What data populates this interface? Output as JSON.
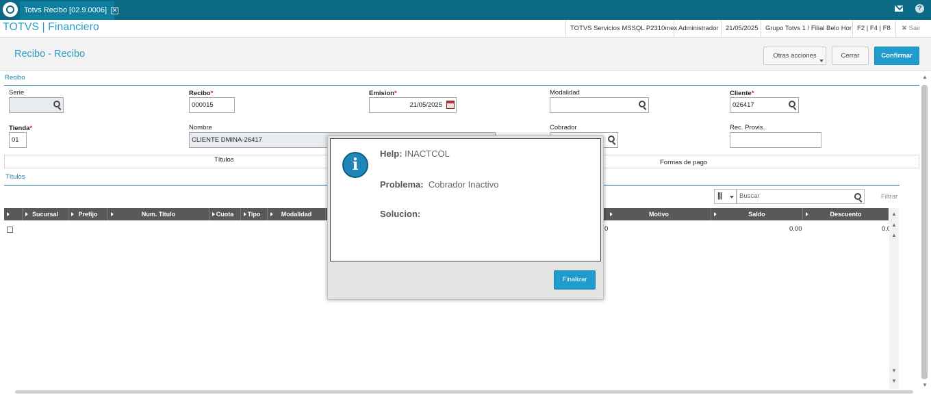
{
  "topbar": {
    "tab_label": "Totvs Recibo [02.9.0006]",
    "tab_close": "✕",
    "help_glyph": "?"
  },
  "subbar": {
    "app_title": "TOTVS | Financiero",
    "server": "TOTVS Servicios MSSQL P2310mex",
    "user": "Administrador",
    "date": "21/05/2025",
    "branch": "Grupo Totvs 1 / Filial Belo Hor",
    "shortcuts": "F2 | F4 | F8",
    "exit": "Sair"
  },
  "header": {
    "title": "Recibo - Recibo",
    "other_actions": "Otras acciones",
    "close": "Cerrar",
    "confirm": "Confirmar"
  },
  "form": {
    "section": "Recibo",
    "serie_label": "Serie",
    "serie_value": "",
    "recibo_label": "Recibo",
    "recibo_value": "000015",
    "emision_label": "Emision",
    "emision_value": "21/05/2025",
    "modalidad_label": "Modalidad",
    "modalidad_value": "",
    "cliente_label": "Cliente",
    "cliente_value": "026417",
    "tienda_label": "Tienda",
    "tienda_value": "01",
    "nombre_label": "Nombre",
    "nombre_value": "CLIENTE DMINA-26417",
    "cobrador_label": "Cobrador",
    "cobrador_value": "",
    "recprovis_label": "Rec. Provis.",
    "recprovis_value": "",
    "required_mark": "*"
  },
  "tabs": {
    "titulos": "Títulos",
    "formas": "Formas de pago"
  },
  "grid": {
    "section": "Títulos",
    "search_placeholder": "Buscar",
    "filter": "Filtrar",
    "columns": [
      "Sucursal",
      "Prefijo",
      "Num. Titulo",
      "Cuota",
      "Tipo",
      "Modalidad",
      "Motivo",
      "Saldo",
      "Descuento"
    ],
    "row": {
      "partial": "0",
      "saldo": "0.00",
      "descuento": "0.0"
    }
  },
  "modal": {
    "help_label": "Help:",
    "help_value": "INACTCOL",
    "problem_label": "Problema:",
    "problem_value": "Cobrador Inactivo",
    "solution_label": "Solucion:",
    "solution_value": "",
    "button": "Finalizar",
    "icon_glyph": "i"
  },
  "colors": {
    "topbar": "#0b6a86",
    "accent": "#2d9cc5",
    "primary_button": "#1f9ccd",
    "grid_header": "#595959",
    "required": "#e02020"
  }
}
